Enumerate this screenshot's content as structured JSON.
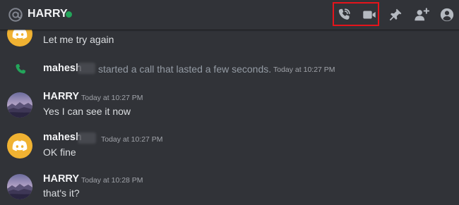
{
  "header": {
    "title": "HARRY",
    "status": "online",
    "status_color": "#23a55a",
    "icons": [
      "voice-call-icon",
      "video-call-icon",
      "pinned-messages-icon",
      "add-friends-to-dm-icon",
      "user-profile-icon"
    ]
  },
  "messages": [
    {
      "type": "text",
      "author_avatar": "discord-logo-avatar",
      "text": "Let me try again"
    },
    {
      "type": "call",
      "author": "mahesh",
      "text": "started a call that lasted a few seconds.",
      "timestamp": "Today at 10:27 PM"
    },
    {
      "type": "text",
      "author": "HARRY",
      "author_avatar": "landscape-avatar",
      "timestamp": "Today at 10:27 PM",
      "text": "Yes I can see it now"
    },
    {
      "type": "text",
      "author": "mahesh",
      "author_avatar": "discord-logo-avatar",
      "timestamp": "Today at 10:27 PM",
      "text": "OK fine"
    },
    {
      "type": "text",
      "author": "HARRY",
      "author_avatar": "landscape-avatar",
      "timestamp": "Today at 10:28 PM",
      "text": "that's it?"
    }
  ],
  "colors": {
    "background": "#313338",
    "highlight": "#e5141b",
    "call_green": "#23a55a",
    "discord_avatar_bg": "#f0b232"
  }
}
